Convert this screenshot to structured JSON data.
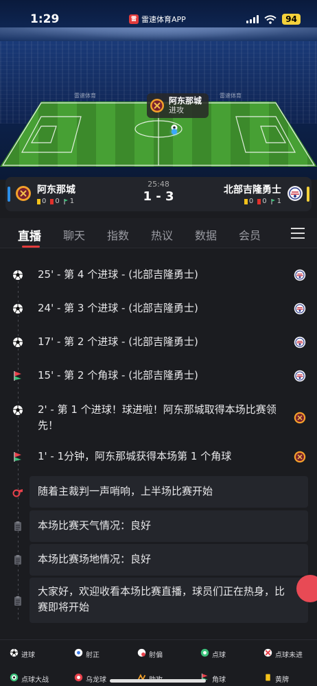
{
  "status_bar": {
    "time": "1:29",
    "app_name": "雷速体育APP",
    "app_logo_text": "雷",
    "battery": "94"
  },
  "stadium": {
    "ad_text": "雷速体育"
  },
  "event_bubble": {
    "team": "阿东那城",
    "action": "进攻"
  },
  "match": {
    "time": "25:48",
    "score": "1 - 3",
    "home": {
      "name": "阿东那城",
      "yellow": "0",
      "red": "0",
      "corners": "1"
    },
    "away": {
      "name": "北部吉隆勇士",
      "yellow": "0",
      "red": "0",
      "corners": "1"
    }
  },
  "tabs": [
    "直播",
    "聊天",
    "指数",
    "热议",
    "数据",
    "会员"
  ],
  "events": [
    {
      "text": "25' - 第 4 个进球 - (北部吉隆勇士)",
      "icon": "goal-icon",
      "team": "away"
    },
    {
      "text": "24' - 第 3 个进球 - (北部吉隆勇士)",
      "icon": "goal-icon",
      "team": "away"
    },
    {
      "text": "17' - 第 2 个进球 - (北部吉隆勇士)",
      "icon": "goal-icon",
      "team": "away"
    },
    {
      "text": "15' - 第 2 个角球 - (北部吉隆勇士)",
      "icon": "corner-flag-icon",
      "team": "away"
    },
    {
      "text": "2' - 第 1 个进球！球进啦！阿东那城取得本场比赛领先！",
      "icon": "goal-icon",
      "team": "home"
    },
    {
      "text": "1' - 1分钟，阿东那城获得本场第 1 个角球",
      "icon": "corner-flag-icon",
      "team": "home"
    },
    {
      "text": "随着主裁判一声哨响，上半场比赛开始",
      "icon": "whistle-icon",
      "team": ""
    },
    {
      "text": "本场比赛天气情况：良好",
      "icon": "clipboard-icon",
      "team": ""
    },
    {
      "text": "本场比赛场地情况：良好",
      "icon": "clipboard-icon",
      "team": ""
    },
    {
      "text": "大家好，欢迎收看本场比赛直播，球员们正在热身，比赛即将开始",
      "icon": "clipboard-icon",
      "team": ""
    }
  ],
  "legend": [
    {
      "label": "进球",
      "icon": "goal-icon"
    },
    {
      "label": "射正",
      "icon": "shot-on-target-icon"
    },
    {
      "label": "射偏",
      "icon": "shot-off-target-icon"
    },
    {
      "label": "点球",
      "icon": "penalty-icon"
    },
    {
      "label": "点球未进",
      "icon": "penalty-missed-icon"
    },
    {
      "label": "点球大战",
      "icon": "penalty-shootout-icon"
    },
    {
      "label": "乌龙球",
      "icon": "own-goal-icon"
    },
    {
      "label": "助攻",
      "icon": "assist-icon"
    },
    {
      "label": "角球",
      "icon": "corner-flag-icon"
    },
    {
      "label": "黄牌",
      "icon": "yellow-card-icon"
    }
  ],
  "colors": {
    "accent": "#e23b3b",
    "home_stripe": "#2c8ee8",
    "away_stripe": "#f4d13b",
    "pitch": "#47a034"
  }
}
